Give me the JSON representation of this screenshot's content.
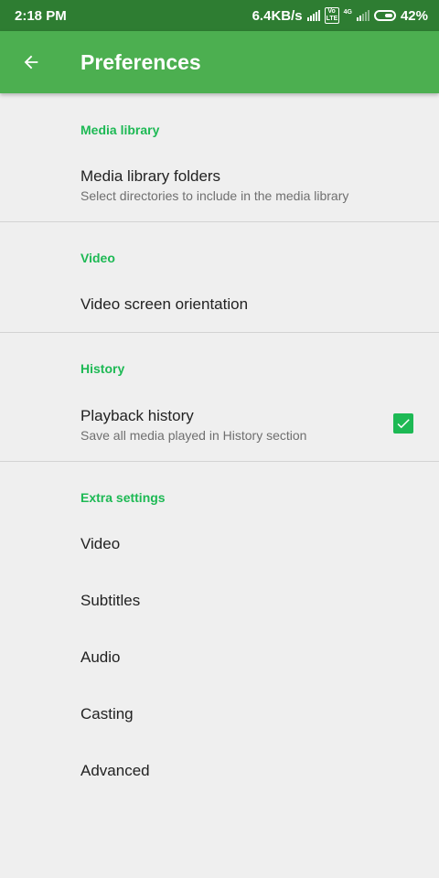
{
  "status_bar": {
    "time": "2:18 PM",
    "net_speed": "6.4KB/s",
    "volte": "Vo LTE",
    "network_type": "4G",
    "battery": "42%"
  },
  "toolbar": {
    "back_icon": "arrow-back-icon",
    "title": "Preferences"
  },
  "sections": {
    "media_library": {
      "header": "Media library",
      "folders_title": "Media library folders",
      "folders_summary": "Select directories to include in the media library"
    },
    "video": {
      "header": "Video",
      "orientation_title": "Video screen orientation"
    },
    "history": {
      "header": "History",
      "playback_title": "Playback history",
      "playback_summary": "Save all media played in History section",
      "playback_checked": true
    },
    "extra": {
      "header": "Extra settings",
      "items": [
        "Video",
        "Subtitles",
        "Audio",
        "Casting",
        "Advanced"
      ]
    }
  },
  "colors": {
    "status_bar": "#2e7d32",
    "toolbar": "#4caf50",
    "accent": "#1db954",
    "background": "#efefef"
  }
}
